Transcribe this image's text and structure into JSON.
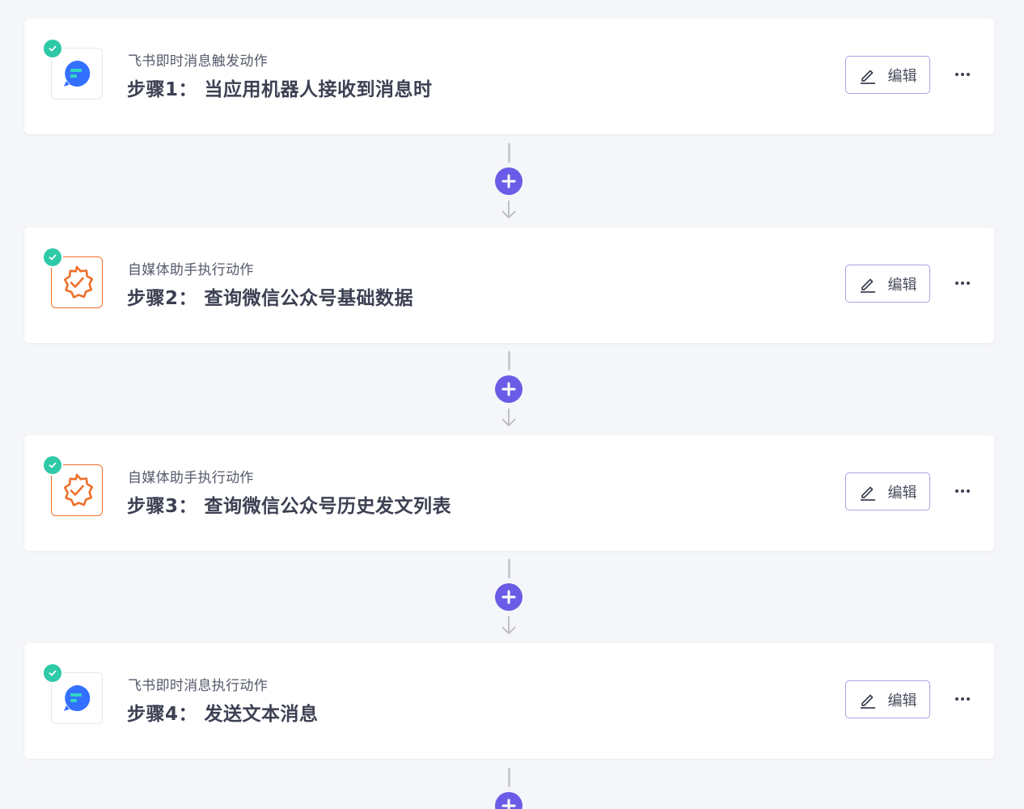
{
  "steps": [
    {
      "app": "feishu",
      "subtitle": "飞书即时消息触发动作",
      "title": "步骤1： 当应用机器人接收到消息时",
      "edit_label": "编辑",
      "status": "complete"
    },
    {
      "app": "media-assistant",
      "subtitle": "自媒体助手执行动作",
      "title": "步骤2： 查询微信公众号基础数据",
      "edit_label": "编辑",
      "status": "complete"
    },
    {
      "app": "media-assistant",
      "subtitle": "自媒体助手执行动作",
      "title": "步骤3： 查询微信公众号历史发文列表",
      "edit_label": "编辑",
      "status": "complete"
    },
    {
      "app": "feishu",
      "subtitle": "飞书即时消息执行动作",
      "title": "步骤4： 发送文本消息",
      "edit_label": "编辑",
      "status": "complete"
    }
  ],
  "icons": {
    "status": "check-circle-icon",
    "edit": "pencil-icon",
    "more": "more-horizontal-icon",
    "add": "plus-circle-icon",
    "arrow": "arrow-down-icon",
    "feishu": "feishu-messenger-icon",
    "media": "verified-badge-icon"
  },
  "colors": {
    "accent": "#6b5ce7",
    "status_complete": "#2ec9a7",
    "feishu_blue": "#3370ff",
    "media_orange": "#ee6f2a",
    "edit_border": "#a9a2e6"
  }
}
